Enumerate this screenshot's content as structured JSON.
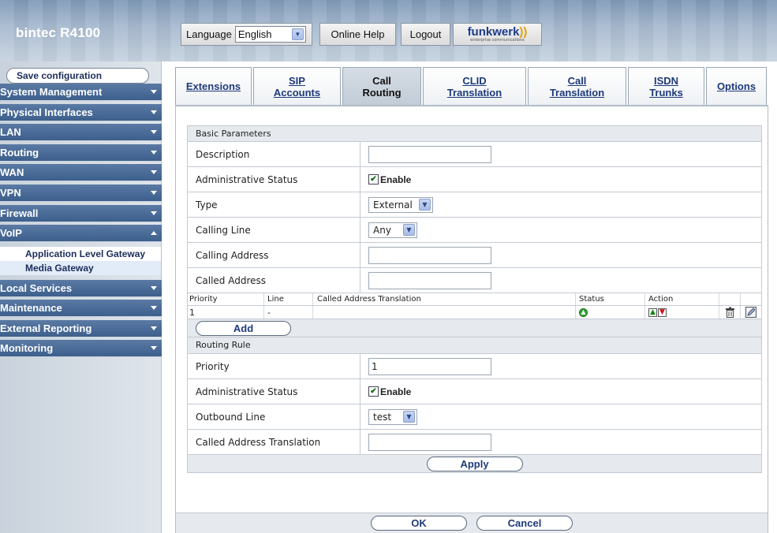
{
  "header": {
    "brand": "bintec R4100",
    "language_label": "Language",
    "language_value": "English",
    "online_help": "Online Help",
    "logout": "Logout",
    "logo_text": "funkwerk",
    "logo_tagline": "enterprise communications"
  },
  "sidebar": {
    "save_label": "Save configuration",
    "items": [
      {
        "label": "System Management",
        "expanded": false
      },
      {
        "label": "Physical Interfaces",
        "expanded": false
      },
      {
        "label": "LAN",
        "expanded": false
      },
      {
        "label": "Routing",
        "expanded": false
      },
      {
        "label": "WAN",
        "expanded": false
      },
      {
        "label": "VPN",
        "expanded": false
      },
      {
        "label": "Firewall",
        "expanded": false
      },
      {
        "label": "VoIP",
        "expanded": true
      },
      {
        "label": "Local Services",
        "expanded": false
      },
      {
        "label": "Maintenance",
        "expanded": false
      },
      {
        "label": "External Reporting",
        "expanded": false
      },
      {
        "label": "Monitoring",
        "expanded": false
      }
    ],
    "voip_sub": [
      {
        "label": "Application Level Gateway",
        "active": false
      },
      {
        "label": "Media Gateway",
        "active": true
      }
    ]
  },
  "tabs": [
    {
      "line1": "Extensions",
      "line2": "",
      "active": false
    },
    {
      "line1": "SIP",
      "line2": "Accounts",
      "active": false
    },
    {
      "line1": "Call",
      "line2": "Routing",
      "active": true
    },
    {
      "line1": "CLID",
      "line2": "Translation",
      "active": false
    },
    {
      "line1": "Call",
      "line2": "Translation",
      "active": false
    },
    {
      "line1": "ISDN",
      "line2": "Trunks",
      "active": false
    },
    {
      "line1": "Options",
      "line2": "",
      "active": false
    }
  ],
  "basic": {
    "heading": "Basic Parameters",
    "description_label": "Description",
    "description_value": "",
    "admin_status_label": "Administrative Status",
    "admin_status_checkbox": "Enable",
    "type_label": "Type",
    "type_value": "External",
    "calling_line_label": "Calling Line",
    "calling_line_value": "Any",
    "calling_address_label": "Calling Address",
    "calling_address_value": "",
    "called_address_label": "Called Address",
    "called_address_value": ""
  },
  "table": {
    "headers": {
      "priority": "Priority",
      "line": "Line",
      "translation": "Called Address Translation",
      "status": "Status",
      "action": "Action"
    },
    "rows": [
      {
        "priority": "1",
        "line": "-",
        "translation": "",
        "status": "active"
      }
    ],
    "add_label": "Add"
  },
  "rule": {
    "heading": "Routing Rule",
    "priority_label": "Priority",
    "priority_value": "1",
    "admin_status_label": "Administrative Status",
    "admin_status_checkbox": "Enable",
    "outbound_label": "Outbound Line",
    "outbound_value": "test",
    "translation_label": "Called Address Translation",
    "translation_value": "",
    "apply_label": "Apply"
  },
  "footer": {
    "ok_label": "OK",
    "cancel_label": "Cancel"
  }
}
